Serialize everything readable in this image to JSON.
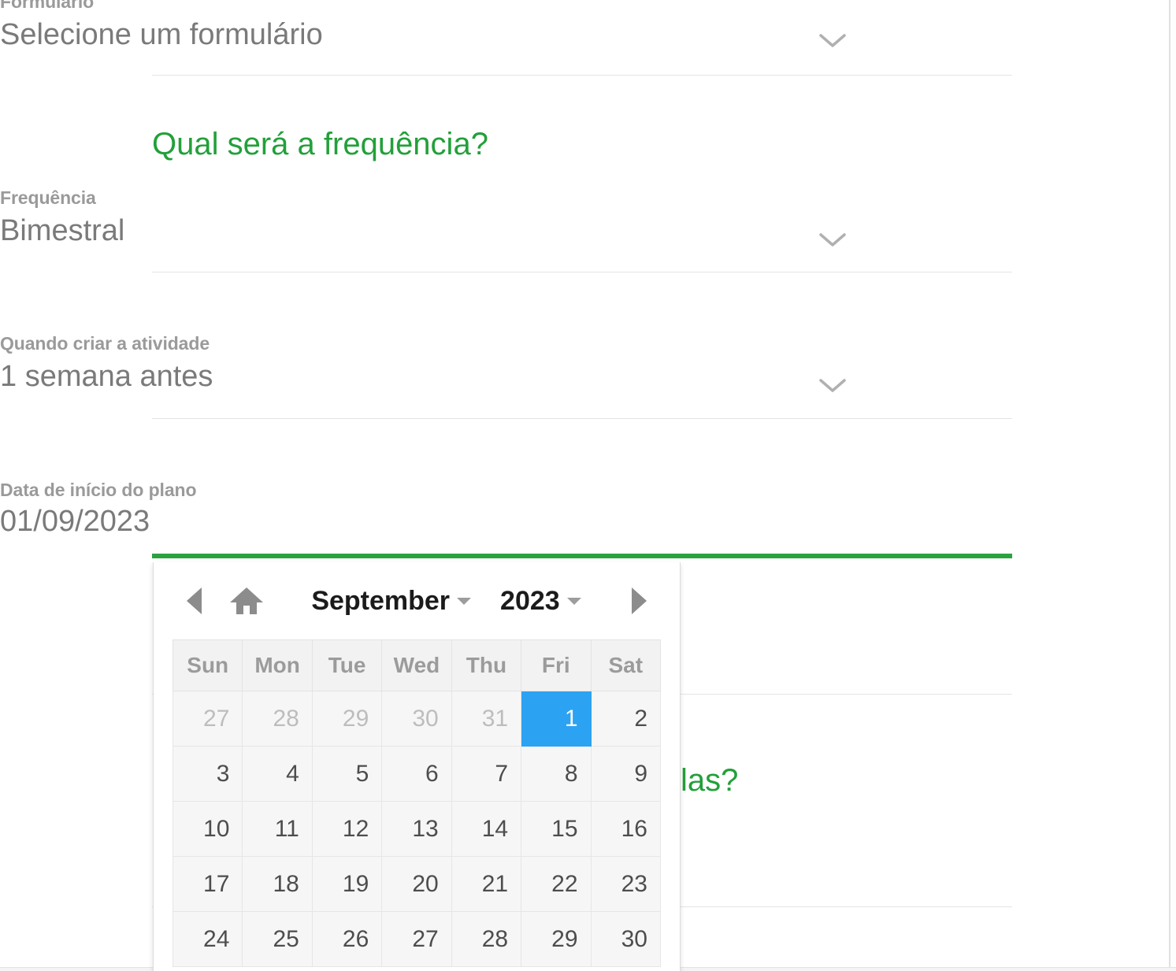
{
  "form": {
    "fields": [
      {
        "label": "Formulário",
        "value": "Selecione um formulário",
        "icon": "chevron-down-icon"
      },
      {
        "label": "Frequência",
        "value": "Bimestral",
        "icon": "chevron-down-icon"
      },
      {
        "label": "Quando criar a atividade",
        "value": "1 semana antes",
        "icon": "chevron-down-icon"
      },
      {
        "label": "Data de início do plano",
        "value": "01/09/2023",
        "icon": "none"
      }
    ]
  },
  "headings": {
    "frequency": "Qual será a frequência?",
    "obscured_partial": "las?"
  },
  "datepicker": {
    "prev_icon": "triangle-left-icon",
    "home_icon": "home-icon",
    "next_icon": "triangle-right-icon",
    "month": "September",
    "year": "2023",
    "month_caret_icon": "caret-down-icon",
    "year_caret_icon": "caret-down-icon",
    "weekdays": [
      "Sun",
      "Mon",
      "Tue",
      "Wed",
      "Thu",
      "Fri",
      "Sat"
    ],
    "weeks": [
      [
        {
          "d": "27",
          "m": "prev"
        },
        {
          "d": "28",
          "m": "prev"
        },
        {
          "d": "29",
          "m": "prev"
        },
        {
          "d": "30",
          "m": "prev"
        },
        {
          "d": "31",
          "m": "prev"
        },
        {
          "d": "1",
          "m": "cur",
          "selected": true
        },
        {
          "d": "2",
          "m": "cur"
        }
      ],
      [
        {
          "d": "3",
          "m": "cur"
        },
        {
          "d": "4",
          "m": "cur"
        },
        {
          "d": "5",
          "m": "cur"
        },
        {
          "d": "6",
          "m": "cur"
        },
        {
          "d": "7",
          "m": "cur"
        },
        {
          "d": "8",
          "m": "cur"
        },
        {
          "d": "9",
          "m": "cur"
        }
      ],
      [
        {
          "d": "10",
          "m": "cur"
        },
        {
          "d": "11",
          "m": "cur"
        },
        {
          "d": "12",
          "m": "cur"
        },
        {
          "d": "13",
          "m": "cur"
        },
        {
          "d": "14",
          "m": "cur"
        },
        {
          "d": "15",
          "m": "cur"
        },
        {
          "d": "16",
          "m": "cur"
        }
      ],
      [
        {
          "d": "17",
          "m": "cur"
        },
        {
          "d": "18",
          "m": "cur"
        },
        {
          "d": "19",
          "m": "cur"
        },
        {
          "d": "20",
          "m": "cur"
        },
        {
          "d": "21",
          "m": "cur"
        },
        {
          "d": "22",
          "m": "cur"
        },
        {
          "d": "23",
          "m": "cur"
        }
      ],
      [
        {
          "d": "24",
          "m": "cur"
        },
        {
          "d": "25",
          "m": "cur"
        },
        {
          "d": "26",
          "m": "cur"
        },
        {
          "d": "27",
          "m": "cur"
        },
        {
          "d": "28",
          "m": "cur"
        },
        {
          "d": "29",
          "m": "cur"
        },
        {
          "d": "30",
          "m": "cur"
        }
      ]
    ]
  },
  "colors": {
    "accent_green": "#22a03a",
    "focus_underline": "#2aa33f",
    "selected_day": "#2ca2f2",
    "label_gray": "#9a9a9a",
    "value_gray": "#7a7a7a"
  }
}
